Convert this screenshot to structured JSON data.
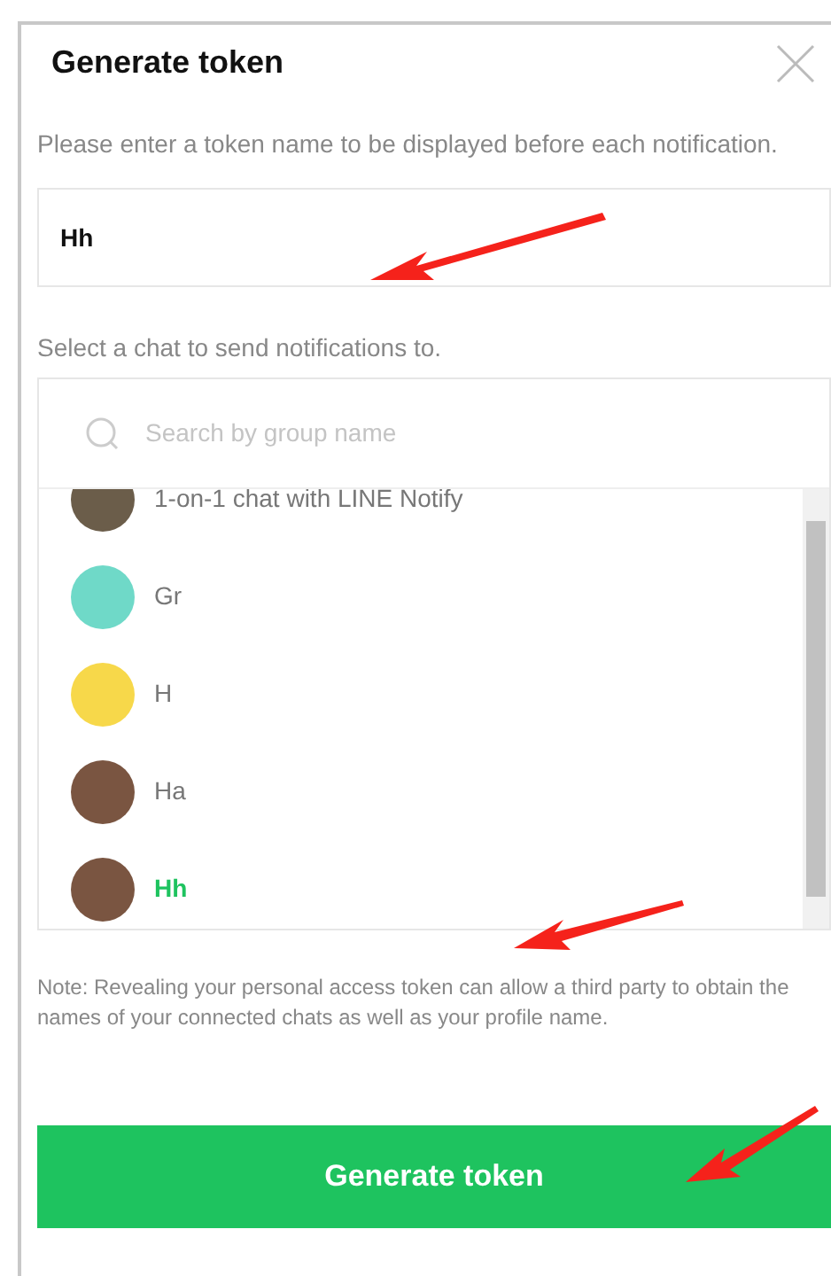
{
  "dialog": {
    "title": "Generate token"
  },
  "token_name": {
    "label": "Please enter a token name to be displayed before each notification.",
    "value": "Hh"
  },
  "chat_select": {
    "label": "Select a chat to send notifications to.",
    "search": {
      "placeholder": "Search by group name"
    },
    "chats": [
      {
        "name": "1-on-1 chat with LINE Notify",
        "color": "#6b5d4a",
        "selected": false
      },
      {
        "name": "Gr",
        "color": "#6fd9c8",
        "selected": false
      },
      {
        "name": "H",
        "color": "#f7d84a",
        "selected": false
      },
      {
        "name": "Ha",
        "color": "#7a5541",
        "selected": false
      },
      {
        "name": "Hh",
        "color": "#7a5541",
        "selected": true
      }
    ]
  },
  "note": "Note: Revealing your personal access token can allow a third party to obtain the names of your connected chats as well as your profile name.",
  "submit_button": "Generate token"
}
